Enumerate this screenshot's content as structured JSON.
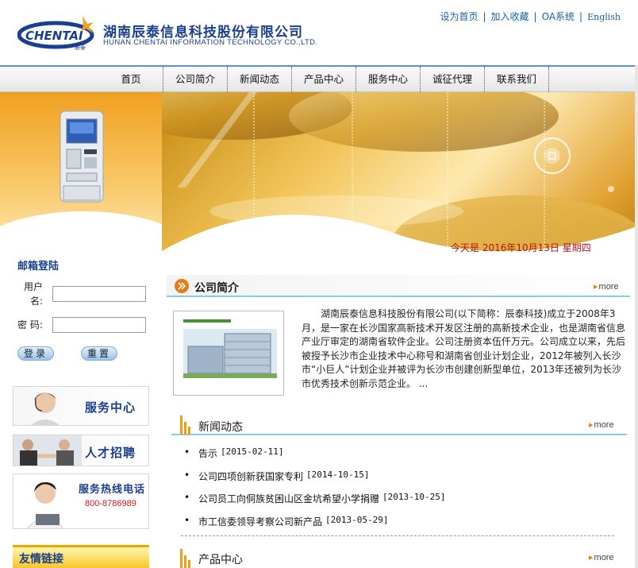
{
  "header": {
    "company_cn": "湖南辰泰信息科技股份有限公司",
    "company_en": "HUNAN CHENTAI INFORMATION TECHNOLOGY CO.,LTD.",
    "logo_text": "CHENTAI",
    "logo_sub": "辰泰",
    "top_links": [
      "设为首页",
      "加入收藏",
      "OA系统",
      "English"
    ]
  },
  "nav": {
    "items": [
      "首页",
      "公司简介",
      "新闻动态",
      "产品中心",
      "服务中心",
      "诚征代理",
      "联系我们"
    ]
  },
  "login": {
    "title": "邮箱登陆",
    "user_label": "用户名:",
    "pass_label": "密  码:",
    "login_btn": "登录",
    "reset_btn": "重置"
  },
  "side_banners": {
    "service_center": "服务中心",
    "recruit": "人才招聘",
    "hotline_title": "服务热线电话",
    "hotline_number": "800-8786989"
  },
  "friend_links": {
    "title": "友情链接"
  },
  "date_line": "今天是 2016年10月13日 星期四",
  "intro": {
    "title": "公司简介",
    "more": "more",
    "text": "湖南辰泰信息科技股份有限公司(以下简称：辰泰科技)成立于2008年3月，是一家在长沙国家高新技术开发区注册的高新技术企业，也是湖南省信息产业厅审定的湖南省软件企业。公司注册资本伍仟万元。公司成立以来，先后被授予长沙市企业技术中心称号和湖南省创业计划企业，2012年被列入长沙市“小巨人”计划企业并被评为长沙市创建创新型单位，2013年还被列为长沙市优秀技术创新示范企业。 ..."
  },
  "news": {
    "title": "新闻动态",
    "more": "more",
    "items": [
      {
        "title": "告示",
        "date": "[2015-02-11]"
      },
      {
        "title": "公司四项创新获国家专利",
        "date": "[2014-10-15]"
      },
      {
        "title": "公司员工向侗族贫困山区金坑希望小学捐赠",
        "date": "[2013-10-25]"
      },
      {
        "title": "市工信委领导考察公司新产品",
        "date": "[2013-05-29]"
      }
    ]
  },
  "products": {
    "title": "产品中心",
    "more": "more"
  },
  "colors": {
    "brand_blue": "#1a3f8f",
    "accent_orange": "#f0a020",
    "date_red": "#b8121b"
  }
}
